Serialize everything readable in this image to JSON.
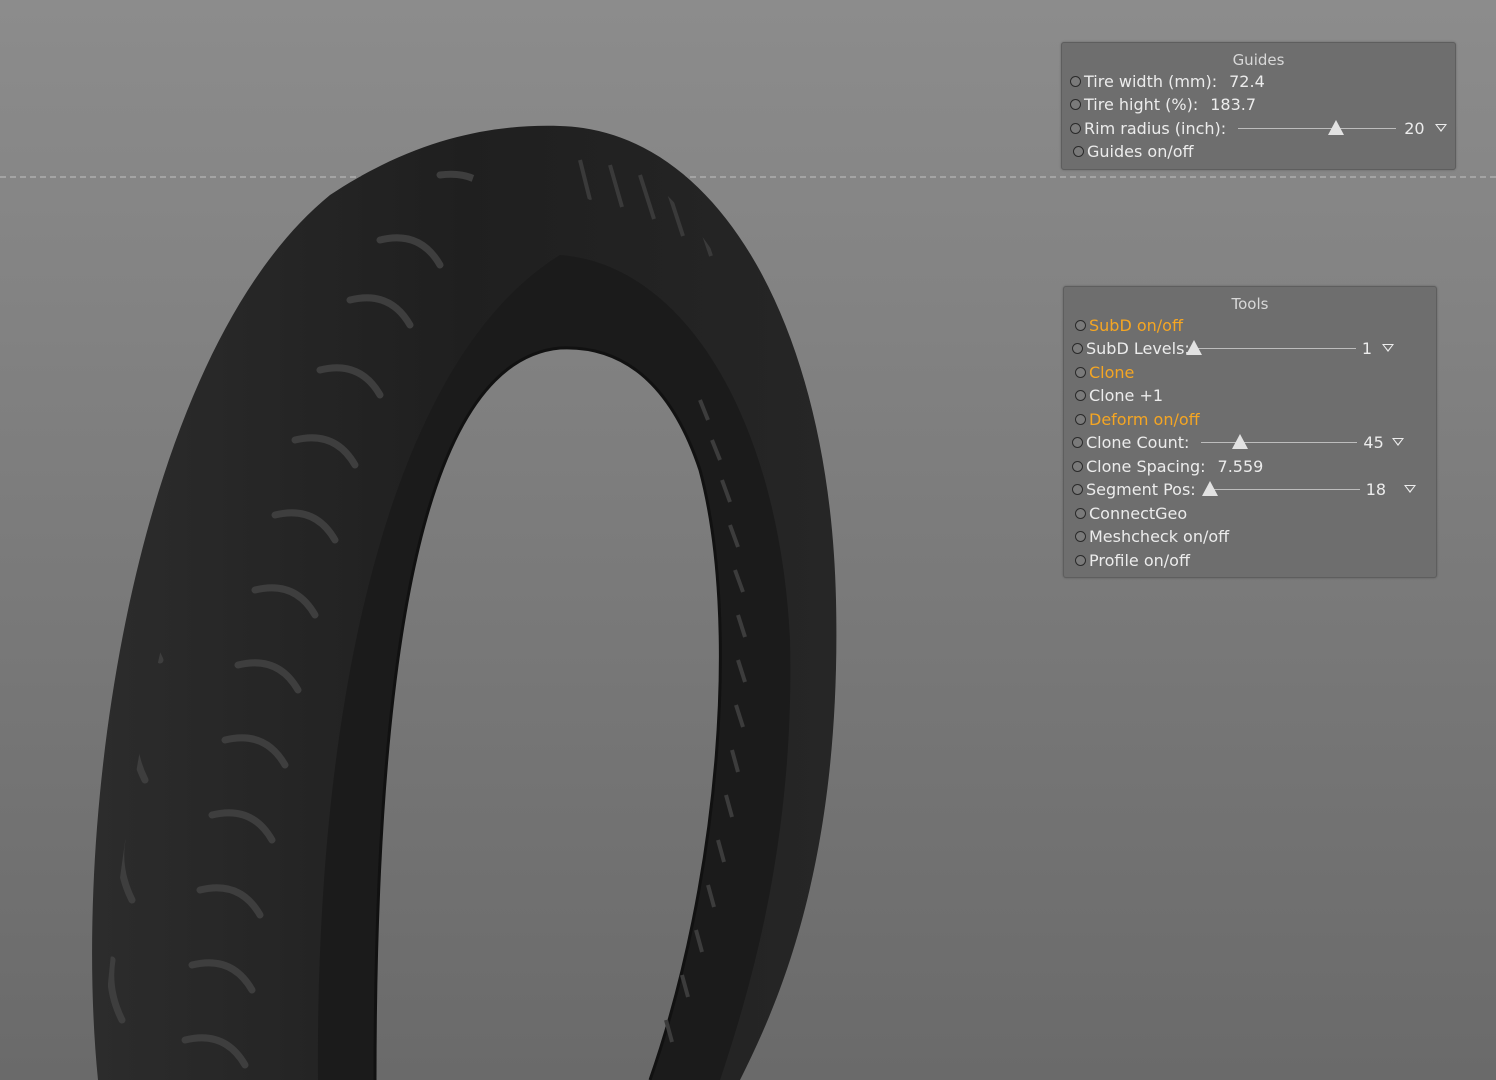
{
  "colors": {
    "panel_bg": "#6e6e6e",
    "label_text": "#ececec",
    "active_label": "#f5a623",
    "viewport_bg": "#7d7d7d"
  },
  "guides": {
    "title": "Guides",
    "tire_width": {
      "label": "Tire width (mm):",
      "value": "72.4"
    },
    "tire_height": {
      "label": "Tire hight (%):",
      "value": "183.7"
    },
    "rim_radius": {
      "label": "Rim radius (inch):",
      "value": "20",
      "slider_fraction": 0.62
    },
    "guides_toggle": {
      "label": "Guides on/off"
    }
  },
  "tools": {
    "title": "Tools",
    "subd_toggle": {
      "label": "SubD on/off",
      "highlighted": true
    },
    "subd_levels": {
      "label": "SubD Levels:",
      "value": "1",
      "slider_fraction": 0.0
    },
    "clone": {
      "label": "Clone",
      "highlighted": true
    },
    "clone_plus": {
      "label": "Clone +1"
    },
    "deform_toggle": {
      "label": "Deform on/off",
      "highlighted": true
    },
    "clone_count": {
      "label": "Clone Count:",
      "value": "45",
      "slider_fraction": 0.25
    },
    "clone_spacing": {
      "label": "Clone Spacing:",
      "value": "7.559"
    },
    "segment_pos": {
      "label": "Segment Pos:",
      "value": "18",
      "slider_fraction": 0.0
    },
    "connect_geo": {
      "label": "ConnectGeo"
    },
    "meshcheck": {
      "label": "Meshcheck on/off"
    },
    "profile": {
      "label": "Profile on/off"
    }
  },
  "icons": {
    "radio": "radio-button-icon",
    "dropdown": "dropdown-triangle-icon",
    "slider_thumb": "slider-thumb-icon"
  }
}
